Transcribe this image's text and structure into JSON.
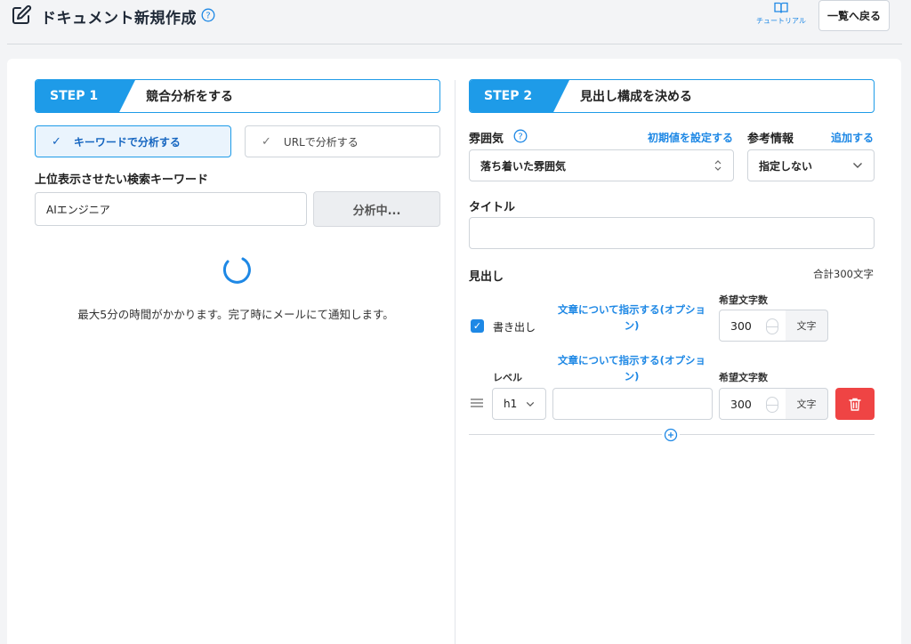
{
  "header": {
    "title": "ドキュメント新規作成",
    "tutorial_label": "チュートリアル",
    "back_label": "一覧へ戻る"
  },
  "step1": {
    "tag": "STEP 1",
    "title": "競合分析をする",
    "mode_keyword": "キーワードで分析する",
    "mode_url": "URLで分析する",
    "keyword_label": "上位表示させたい検索キーワード",
    "keyword_value": "AIエンジニア",
    "analyze_label": "分析中...",
    "notice": "最大5分の時間がかかります。完了時にメールにて通知します。"
  },
  "step2": {
    "tag": "STEP 2",
    "title": "見出し構成を決める",
    "atmosphere_label": "雰囲気",
    "atmosphere_default_link": "初期値を設定する",
    "atmosphere_value": "落ち着いた雰囲気",
    "reference_label": "参考情報",
    "reference_add_link": "追加する",
    "reference_value": "指定しない",
    "title_label": "タイトル",
    "title_value": "",
    "headings_label": "見出し",
    "total_chars": "合計300文字",
    "row1": {
      "instruction_link": "文章について指示する(オプション)",
      "char_count_label": "希望文字数",
      "checkbox_label": "書き出し",
      "char_count_value": "300",
      "unit": "文字"
    },
    "row2": {
      "level_label": "レベル",
      "instruction_link": "文章について指示する(オプション)",
      "char_count_label": "希望文字数",
      "level_value": "h1",
      "heading_value": "",
      "char_count_value": "300",
      "unit": "文字"
    }
  },
  "colors": {
    "accent": "#1e9be8",
    "link": "#1e88e5",
    "danger": "#ef4444"
  }
}
